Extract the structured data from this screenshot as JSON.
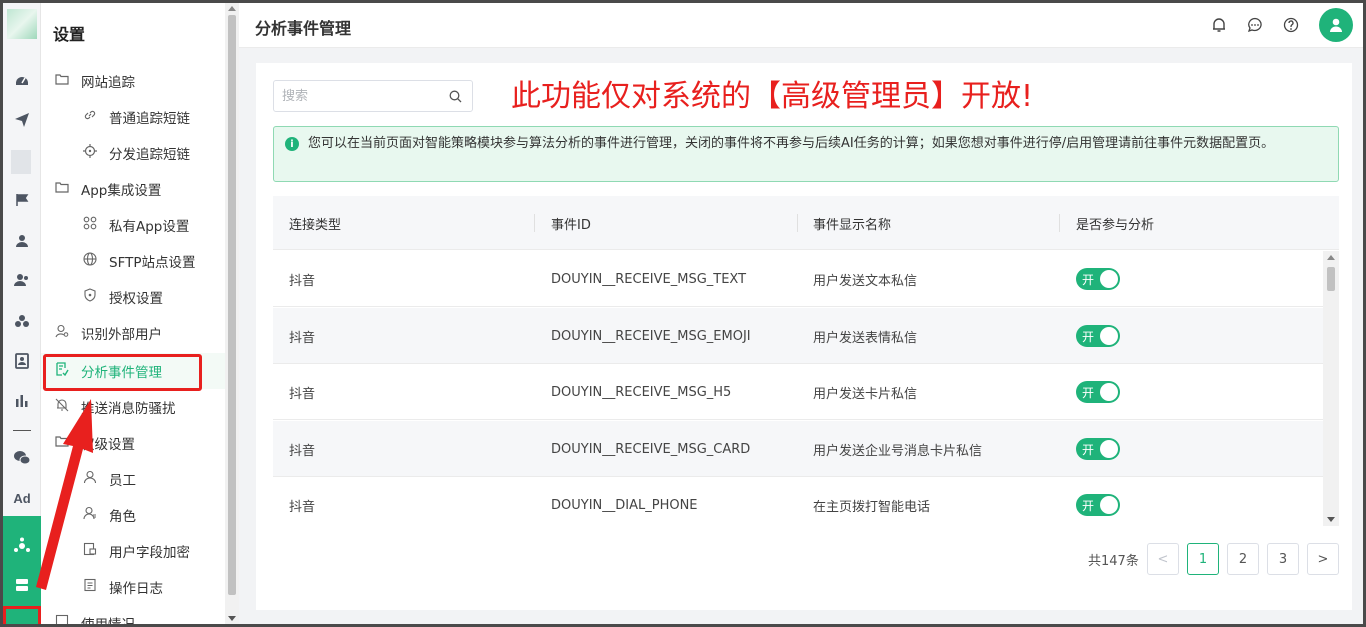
{
  "sidebar": {
    "title": "设置",
    "items": [
      {
        "label": "网站追踪",
        "icon": "folder-icon",
        "level": 1
      },
      {
        "label": "普通追踪短链",
        "icon": "link-icon",
        "level": 2
      },
      {
        "label": "分发追踪短链",
        "icon": "crosshair-icon",
        "level": 2
      },
      {
        "label": "App集成设置",
        "icon": "folder-icon",
        "level": 1
      },
      {
        "label": "私有App设置",
        "icon": "apps-icon",
        "level": 2
      },
      {
        "label": "SFTP站点设置",
        "icon": "globe-icon",
        "level": 2
      },
      {
        "label": "授权设置",
        "icon": "shield-icon",
        "level": 2
      },
      {
        "label": "识别外部用户",
        "icon": "user-search-icon",
        "level": 1
      },
      {
        "label": "分析事件管理",
        "icon": "event-doc-icon",
        "level": 1,
        "active": true
      },
      {
        "label": "推送消息防骚扰",
        "icon": "bell-off-icon",
        "level": 1
      },
      {
        "label": "权级设置",
        "icon": "folder-icon",
        "level": 1
      },
      {
        "label": "员工",
        "icon": "user-icon",
        "level": 2
      },
      {
        "label": "角色",
        "icon": "role-icon",
        "level": 2
      },
      {
        "label": "用户字段加密",
        "icon": "encrypt-icon",
        "level": 2
      },
      {
        "label": "操作日志",
        "icon": "log-icon",
        "level": 2
      },
      {
        "label": "使用情况",
        "icon": "usage-icon",
        "level": 1
      }
    ]
  },
  "rail": {
    "ad_label": "Ad"
  },
  "header": {
    "title": "分析事件管理"
  },
  "search": {
    "placeholder": "搜索"
  },
  "annotation": {
    "note": "此功能仅对系统的【高级管理员】开放!"
  },
  "alert": {
    "text": "您可以在当前页面对智能策略模块参与算法分析的事件进行管理，关闭的事件将不再参与后续AI任务的计算；如果您想对事件进行停/启用管理请前往事件元数据配置页。"
  },
  "table": {
    "columns": [
      "连接类型",
      "事件ID",
      "事件显示名称",
      "是否参与分析"
    ],
    "rows": [
      {
        "type": "抖音",
        "event_id": "DOUYIN__RECEIVE_MSG_TEXT",
        "name": "用户发送文本私信",
        "switch": "开"
      },
      {
        "type": "抖音",
        "event_id": "DOUYIN__RECEIVE_MSG_EMOJI",
        "name": "用户发送表情私信",
        "switch": "开"
      },
      {
        "type": "抖音",
        "event_id": "DOUYIN__RECEIVE_MSG_H5",
        "name": "用户发送卡片私信",
        "switch": "开"
      },
      {
        "type": "抖音",
        "event_id": "DOUYIN__RECEIVE_MSG_CARD",
        "name": "用户发送企业号消息卡片私信",
        "switch": "开"
      },
      {
        "type": "抖音",
        "event_id": "DOUYIN__DIAL_PHONE",
        "name": "在主页拨打智能电话",
        "switch": "开"
      }
    ]
  },
  "pagination": {
    "total": "共147条",
    "pages": [
      "1",
      "2",
      "3"
    ],
    "prev": "<",
    "next": ">"
  },
  "colors": {
    "accent": "#1fb37a",
    "annotation_red": "#e8201e"
  }
}
